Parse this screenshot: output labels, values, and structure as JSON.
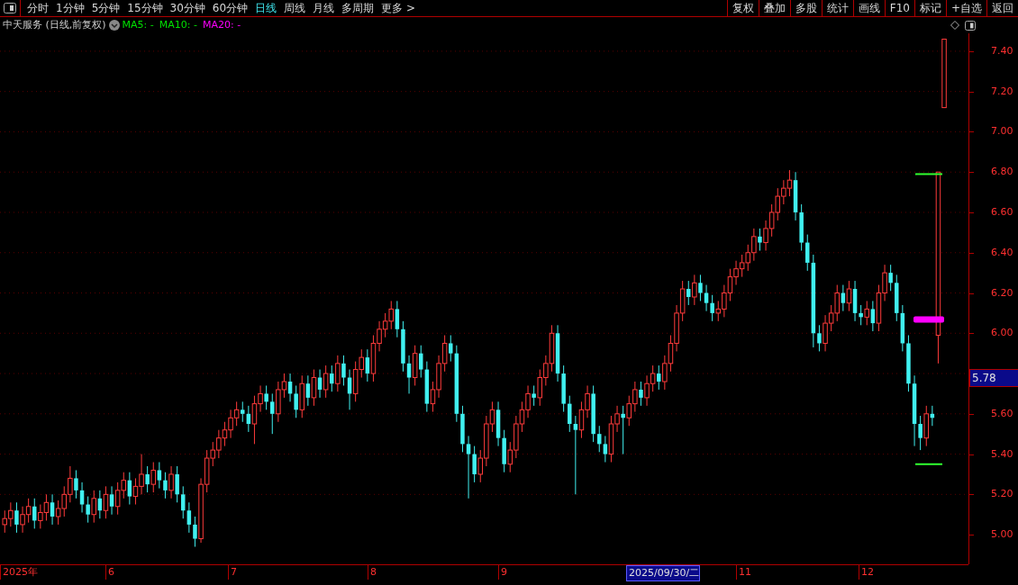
{
  "toolbar": {
    "periods": [
      {
        "label": "分时",
        "selected": false
      },
      {
        "label": "1分钟",
        "selected": false
      },
      {
        "label": "5分钟",
        "selected": false
      },
      {
        "label": "15分钟",
        "selected": false
      },
      {
        "label": "30分钟",
        "selected": false
      },
      {
        "label": "60分钟",
        "selected": false
      },
      {
        "label": "日线",
        "selected": true
      },
      {
        "label": "周线",
        "selected": false
      },
      {
        "label": "月线",
        "selected": false
      },
      {
        "label": "多周期",
        "selected": false
      },
      {
        "label": "更多 >",
        "selected": false
      }
    ],
    "tools": [
      "复权",
      "叠加",
      "多股",
      "统计",
      "画线",
      "F10",
      "标记",
      "+自选",
      "返回"
    ]
  },
  "chart_header": {
    "title": "中天服务 (日线,前复权)",
    "indicators": [
      {
        "label": "MA5: -",
        "color": "#00e000"
      },
      {
        "label": "MA10: -",
        "color": "#00e000"
      },
      {
        "label": "MA20: -",
        "color": "#ff00ff"
      }
    ]
  },
  "chart": {
    "chart_data": {
      "type": "candlestick",
      "ylim": [
        4.853,
        7.489
      ],
      "grid": true,
      "yticks": [
        {
          "value": 7.4,
          "label": "7.40"
        },
        {
          "value": 7.2,
          "label": "7.20"
        },
        {
          "value": 7.0,
          "label": "7.00"
        },
        {
          "value": 6.8,
          "label": "6.80"
        },
        {
          "value": 6.6,
          "label": "6.60"
        },
        {
          "value": 6.4,
          "label": "6.40"
        },
        {
          "value": 6.2,
          "label": "6.20"
        },
        {
          "value": 6.0,
          "label": "6.00"
        },
        {
          "value": 5.6,
          "label": "5.60"
        },
        {
          "value": 5.4,
          "label": "5.40"
        },
        {
          "value": 5.2,
          "label": "5.20"
        },
        {
          "value": 5.0,
          "label": "5.00"
        }
      ],
      "categories": [
        null,
        null,
        null,
        null,
        null,
        null,
        null,
        null,
        null,
        null,
        null,
        null,
        null,
        null,
        null,
        null,
        null,
        null,
        null,
        null,
        null,
        null,
        null,
        null,
        null,
        null,
        null,
        null,
        null,
        null,
        null,
        null,
        null,
        null,
        null,
        null,
        null,
        null,
        null,
        null,
        null,
        null,
        null,
        null,
        null,
        null,
        null,
        null,
        null,
        null,
        null,
        null,
        null,
        null,
        null,
        null,
        null,
        null,
        null,
        null,
        null,
        null,
        null,
        null,
        null,
        null,
        null,
        null,
        null,
        null,
        null,
        null,
        null,
        null,
        null,
        null,
        null,
        null,
        null,
        null,
        null,
        null,
        null,
        null,
        null,
        null,
        null,
        null,
        null,
        null,
        null,
        null,
        null,
        null,
        null,
        null,
        null,
        null,
        null,
        null,
        null,
        null,
        null,
        null,
        null,
        null,
        null,
        null,
        null,
        null,
        null,
        null,
        null,
        null,
        null,
        null,
        null,
        null,
        null,
        null,
        null,
        null,
        null,
        null,
        null,
        null,
        null,
        null,
        null,
        null,
        null,
        null,
        null,
        null,
        null,
        null,
        null,
        null,
        null,
        null,
        null,
        null,
        null,
        null,
        null,
        null,
        null,
        null,
        null,
        null,
        null,
        null,
        null,
        null,
        null,
        null,
        null,
        null,
        null
      ],
      "ohlc": [
        [
          5.05,
          5.12,
          5.01,
          5.08
        ],
        [
          5.08,
          5.16,
          5.04,
          5.12
        ],
        [
          5.12,
          5.16,
          5.01,
          5.05
        ],
        [
          5.05,
          5.14,
          5.01,
          5.1
        ],
        [
          5.1,
          5.18,
          5.06,
          5.14
        ],
        [
          5.14,
          5.18,
          5.03,
          5.07
        ],
        [
          5.07,
          5.15,
          5.03,
          5.11
        ],
        [
          5.11,
          5.2,
          5.07,
          5.16
        ],
        [
          5.16,
          5.2,
          5.05,
          5.09
        ],
        [
          5.09,
          5.17,
          5.05,
          5.13
        ],
        [
          5.13,
          5.24,
          5.09,
          5.2
        ],
        [
          5.2,
          5.34,
          5.16,
          5.28
        ],
        [
          5.28,
          5.32,
          5.18,
          5.22
        ],
        [
          5.22,
          5.26,
          5.11,
          5.15
        ],
        [
          5.15,
          5.19,
          5.06,
          5.1
        ],
        [
          5.1,
          5.22,
          5.06,
          5.18
        ],
        [
          5.18,
          5.22,
          5.08,
          5.12
        ],
        [
          5.12,
          5.24,
          5.08,
          5.2
        ],
        [
          5.2,
          5.24,
          5.1,
          5.14
        ],
        [
          5.14,
          5.26,
          5.1,
          5.22
        ],
        [
          5.22,
          5.31,
          5.18,
          5.27
        ],
        [
          5.27,
          5.31,
          5.15,
          5.19
        ],
        [
          5.19,
          5.28,
          5.15,
          5.24
        ],
        [
          5.24,
          5.4,
          5.2,
          5.3
        ],
        [
          5.3,
          5.34,
          5.21,
          5.25
        ],
        [
          5.25,
          5.36,
          5.21,
          5.32
        ],
        [
          5.32,
          5.36,
          5.23,
          5.27
        ],
        [
          5.27,
          5.31,
          5.18,
          5.22
        ],
        [
          5.22,
          5.34,
          5.18,
          5.3
        ],
        [
          5.3,
          5.34,
          5.16,
          5.2
        ],
        [
          5.2,
          5.24,
          5.08,
          5.12
        ],
        [
          5.12,
          5.16,
          5.01,
          5.05
        ],
        [
          5.05,
          5.09,
          4.94,
          4.98
        ],
        [
          4.98,
          5.28,
          4.96,
          5.25
        ],
        [
          5.25,
          5.42,
          5.21,
          5.38
        ],
        [
          5.38,
          5.46,
          5.34,
          5.42
        ],
        [
          5.42,
          5.52,
          5.38,
          5.48
        ],
        [
          5.48,
          5.56,
          5.44,
          5.52
        ],
        [
          5.52,
          5.62,
          5.48,
          5.58
        ],
        [
          5.58,
          5.66,
          5.54,
          5.62
        ],
        [
          5.62,
          5.66,
          5.56,
          5.6
        ],
        [
          5.6,
          5.64,
          5.51,
          5.55
        ],
        [
          5.55,
          5.69,
          5.45,
          5.65
        ],
        [
          5.65,
          5.74,
          5.61,
          5.7
        ],
        [
          5.7,
          5.74,
          5.62,
          5.66
        ],
        [
          5.66,
          5.7,
          5.5,
          5.6
        ],
        [
          5.6,
          5.76,
          5.56,
          5.72
        ],
        [
          5.72,
          5.8,
          5.68,
          5.76
        ],
        [
          5.76,
          5.8,
          5.66,
          5.7
        ],
        [
          5.7,
          5.74,
          5.58,
          5.62
        ],
        [
          5.62,
          5.79,
          5.58,
          5.75
        ],
        [
          5.75,
          5.79,
          5.64,
          5.68
        ],
        [
          5.68,
          5.82,
          5.64,
          5.78
        ],
        [
          5.78,
          5.82,
          5.68,
          5.72
        ],
        [
          5.72,
          5.84,
          5.68,
          5.8
        ],
        [
          5.8,
          5.84,
          5.71,
          5.75
        ],
        [
          5.75,
          5.89,
          5.71,
          5.85
        ],
        [
          5.85,
          5.89,
          5.74,
          5.78
        ],
        [
          5.78,
          5.82,
          5.62,
          5.7
        ],
        [
          5.7,
          5.86,
          5.66,
          5.82
        ],
        [
          5.82,
          5.92,
          5.78,
          5.88
        ],
        [
          5.88,
          5.92,
          5.76,
          5.8
        ],
        [
          5.8,
          5.99,
          5.76,
          5.95
        ],
        [
          5.95,
          6.06,
          5.91,
          6.02
        ],
        [
          6.02,
          6.1,
          5.98,
          6.06
        ],
        [
          6.06,
          6.16,
          6.02,
          6.12
        ],
        [
          6.12,
          6.16,
          5.98,
          6.02
        ],
        [
          6.02,
          6.06,
          5.81,
          5.85
        ],
        [
          5.85,
          5.89,
          5.7,
          5.78
        ],
        [
          5.78,
          5.94,
          5.74,
          5.9
        ],
        [
          5.9,
          5.94,
          5.78,
          5.82
        ],
        [
          5.82,
          5.86,
          5.61,
          5.65
        ],
        [
          5.65,
          5.76,
          5.61,
          5.72
        ],
        [
          5.72,
          5.89,
          5.68,
          5.85
        ],
        [
          5.85,
          5.99,
          5.81,
          5.95
        ],
        [
          5.95,
          5.99,
          5.86,
          5.9
        ],
        [
          5.9,
          5.94,
          5.56,
          5.6
        ],
        [
          5.6,
          5.64,
          5.41,
          5.45
        ],
        [
          5.45,
          5.49,
          5.18,
          5.4
        ],
        [
          5.4,
          5.44,
          5.26,
          5.3
        ],
        [
          5.3,
          5.42,
          5.26,
          5.38
        ],
        [
          5.38,
          5.59,
          5.34,
          5.55
        ],
        [
          5.55,
          5.66,
          5.51,
          5.62
        ],
        [
          5.62,
          5.66,
          5.44,
          5.48
        ],
        [
          5.48,
          5.52,
          5.31,
          5.35
        ],
        [
          5.35,
          5.46,
          5.31,
          5.42
        ],
        [
          5.42,
          5.59,
          5.38,
          5.55
        ],
        [
          5.55,
          5.66,
          5.51,
          5.62
        ],
        [
          5.62,
          5.74,
          5.58,
          5.7
        ],
        [
          5.7,
          5.74,
          5.64,
          5.68
        ],
        [
          5.68,
          5.82,
          5.64,
          5.78
        ],
        [
          5.78,
          5.89,
          5.74,
          5.85
        ],
        [
          5.85,
          6.04,
          5.81,
          6.0
        ],
        [
          6.0,
          6.04,
          5.76,
          5.8
        ],
        [
          5.8,
          5.84,
          5.61,
          5.65
        ],
        [
          5.65,
          5.69,
          5.51,
          5.55
        ],
        [
          5.55,
          5.59,
          5.2,
          5.52
        ],
        [
          5.52,
          5.66,
          5.48,
          5.62
        ],
        [
          5.62,
          5.74,
          5.58,
          5.7
        ],
        [
          5.7,
          5.74,
          5.46,
          5.5
        ],
        [
          5.5,
          5.54,
          5.41,
          5.45
        ],
        [
          5.45,
          5.49,
          5.36,
          5.4
        ],
        [
          5.4,
          5.59,
          5.36,
          5.55
        ],
        [
          5.55,
          5.64,
          5.51,
          5.6
        ],
        [
          5.6,
          5.64,
          5.4,
          5.58
        ],
        [
          5.58,
          5.69,
          5.54,
          5.65
        ],
        [
          5.65,
          5.76,
          5.61,
          5.72
        ],
        [
          5.72,
          5.76,
          5.64,
          5.68
        ],
        [
          5.68,
          5.79,
          5.64,
          5.75
        ],
        [
          5.75,
          5.84,
          5.71,
          5.8
        ],
        [
          5.8,
          5.84,
          5.72,
          5.76
        ],
        [
          5.76,
          5.89,
          5.72,
          5.85
        ],
        [
          5.85,
          5.99,
          5.81,
          5.95
        ],
        [
          5.95,
          6.14,
          5.91,
          6.1
        ],
        [
          6.1,
          6.26,
          6.06,
          6.22
        ],
        [
          6.22,
          6.26,
          6.14,
          6.18
        ],
        [
          6.18,
          6.29,
          6.14,
          6.25
        ],
        [
          6.25,
          6.29,
          6.16,
          6.2
        ],
        [
          6.2,
          6.24,
          6.11,
          6.15
        ],
        [
          6.15,
          6.19,
          6.06,
          6.1
        ],
        [
          6.1,
          6.16,
          6.06,
          6.12
        ],
        [
          6.12,
          6.24,
          6.08,
          6.2
        ],
        [
          6.2,
          6.32,
          6.16,
          6.28
        ],
        [
          6.28,
          6.36,
          6.24,
          6.32
        ],
        [
          6.32,
          6.39,
          6.28,
          6.35
        ],
        [
          6.35,
          6.44,
          6.31,
          6.4
        ],
        [
          6.4,
          6.52,
          6.36,
          6.48
        ],
        [
          6.48,
          6.52,
          6.41,
          6.45
        ],
        [
          6.45,
          6.56,
          6.41,
          6.52
        ],
        [
          6.52,
          6.64,
          6.48,
          6.6
        ],
        [
          6.6,
          6.72,
          6.56,
          6.68
        ],
        [
          6.68,
          6.76,
          6.64,
          6.72
        ],
        [
          6.72,
          6.81,
          6.68,
          6.76
        ],
        [
          6.76,
          6.8,
          6.56,
          6.6
        ],
        [
          6.6,
          6.64,
          6.41,
          6.45
        ],
        [
          6.45,
          6.49,
          6.31,
          6.35
        ],
        [
          6.35,
          6.39,
          5.93,
          6.0
        ],
        [
          6.0,
          6.04,
          5.91,
          5.95
        ],
        [
          5.95,
          6.09,
          5.91,
          6.05
        ],
        [
          6.05,
          6.14,
          6.01,
          6.1
        ],
        [
          6.1,
          6.24,
          6.06,
          6.2
        ],
        [
          6.2,
          6.24,
          6.11,
          6.15
        ],
        [
          6.15,
          6.26,
          6.11,
          6.22
        ],
        [
          6.22,
          6.26,
          6.06,
          6.1
        ],
        [
          6.1,
          6.14,
          6.04,
          6.08
        ],
        [
          6.08,
          6.16,
          6.04,
          6.12
        ],
        [
          6.12,
          6.16,
          6.01,
          6.05
        ],
        [
          6.05,
          6.24,
          6.01,
          6.2
        ],
        [
          6.2,
          6.34,
          6.16,
          6.3
        ],
        [
          6.3,
          6.34,
          6.21,
          6.25
        ],
        [
          6.25,
          6.29,
          6.06,
          6.1
        ],
        [
          6.1,
          6.14,
          5.91,
          5.95
        ],
        [
          5.95,
          5.99,
          5.71,
          5.75
        ],
        [
          5.75,
          5.79,
          5.44,
          5.55
        ],
        [
          5.55,
          5.59,
          5.42,
          5.48
        ],
        [
          5.48,
          5.64,
          5.44,
          5.6
        ],
        [
          5.6,
          5.64,
          5.54,
          5.58
        ],
        [
          5.99,
          6.8,
          5.85,
          6.8
        ],
        [
          7.12,
          7.46,
          7.12,
          7.46
        ]
      ]
    }
  },
  "y_axis": {
    "price_tag": "5.78"
  },
  "x_axis": {
    "labels": [
      {
        "label": "2025年",
        "selected": false
      },
      {
        "label": "6",
        "selected": false
      },
      {
        "label": "7",
        "selected": false
      },
      {
        "label": "8",
        "selected": false
      },
      {
        "label": "9",
        "selected": false
      },
      {
        "label": "2025/09/30/二",
        "selected": true
      },
      {
        "label": "11",
        "selected": false
      },
      {
        "label": "12",
        "selected": false
      }
    ]
  }
}
